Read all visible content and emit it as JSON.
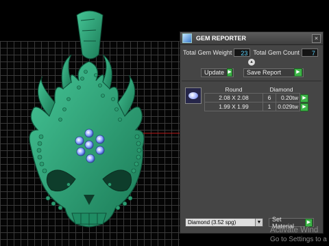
{
  "panel": {
    "title": "GEM REPORTER",
    "close_icon": "close-icon",
    "total_weight_label": "Total Gem Weight",
    "total_weight_value": "23",
    "total_count_label": "Total Gem Count",
    "total_count_value": "7",
    "update_label": "Update",
    "save_report_label": "Save Report",
    "table": {
      "headers": [
        "Round",
        "Diamond"
      ],
      "rows": [
        {
          "size": "2.08 X 2.08",
          "count": "6",
          "weight": "0.20tw"
        },
        {
          "size": "1.99 X 1.99",
          "count": "1",
          "weight": "0.029tw"
        }
      ]
    },
    "material_select": "Diamond    (3.52 spg)",
    "set_material_label": "Set Material"
  },
  "watermark": {
    "line1": "Activate Wind",
    "line2": "Go to Settings to a"
  },
  "colors": {
    "model": "#2fa57a",
    "gem": "#8aa8ff",
    "accent_go": "#3eb449",
    "value_text": "#5cd5ff"
  }
}
